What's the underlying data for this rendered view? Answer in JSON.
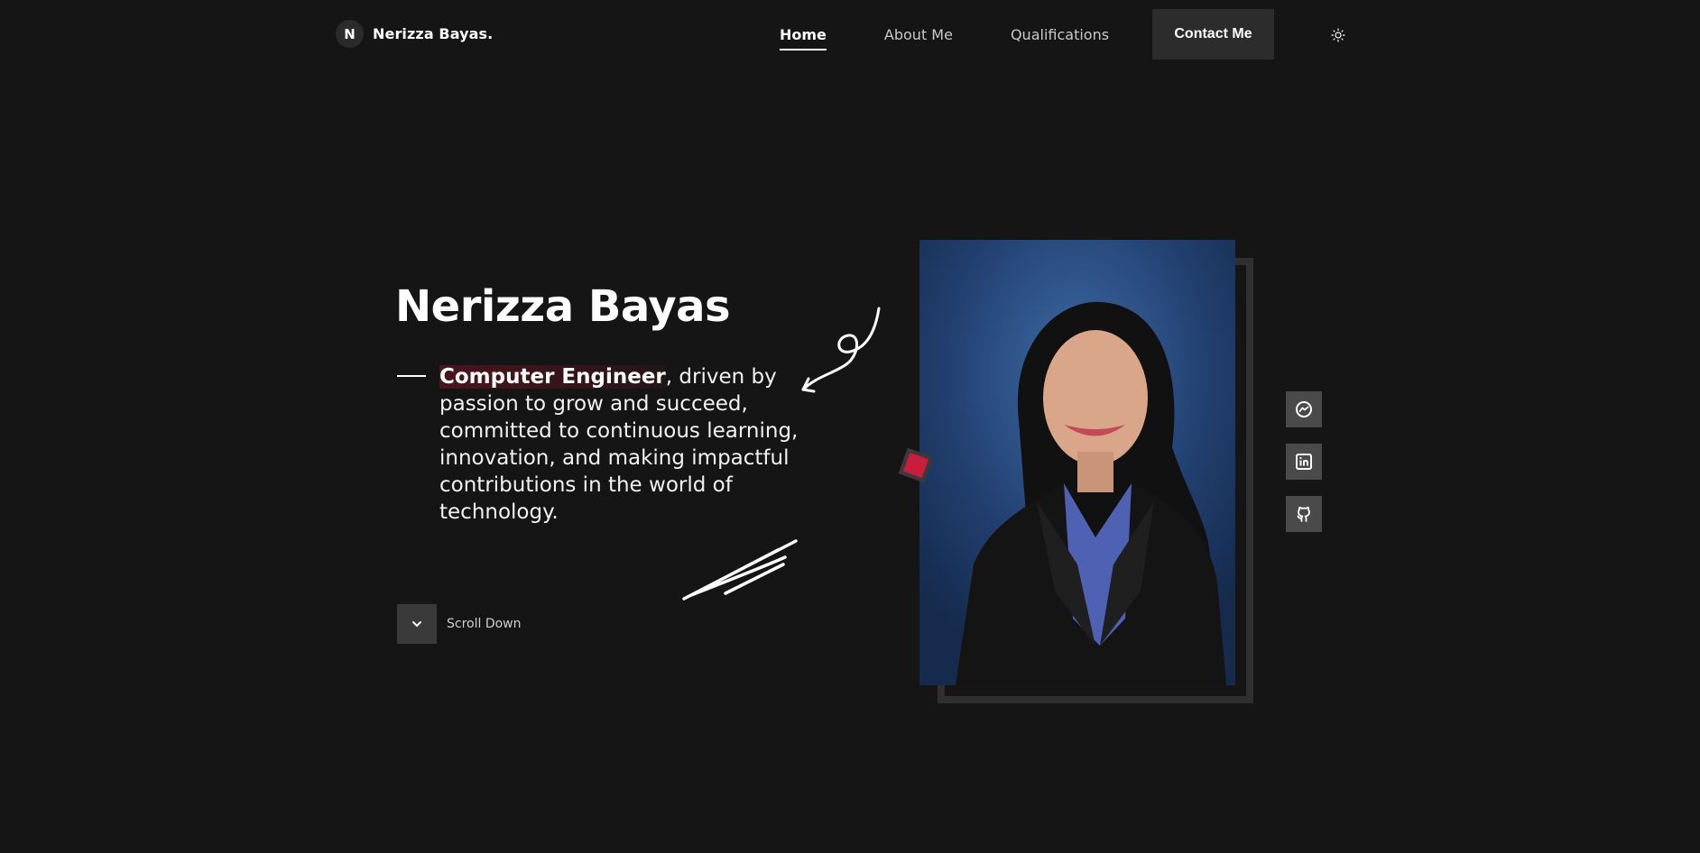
{
  "header": {
    "logo_letter": "N",
    "brand_name": "Nerizza Bayas.",
    "nav": [
      {
        "label": "Home",
        "active": true
      },
      {
        "label": "About Me",
        "active": false
      },
      {
        "label": "Qualifications",
        "active": false
      }
    ],
    "contact_label": "Contact Me",
    "theme_icon": "sun-icon"
  },
  "hero": {
    "name": "Nerizza Bayas",
    "role_highlight": "Computer Engineer",
    "description": ", driven by passion to grow and succeed, committed to continuous learning, innovation, and making impactful contributions in the world of technology.",
    "scroll_label": "Scroll Down"
  },
  "social": [
    {
      "name": "messenger-icon"
    },
    {
      "name": "linkedin-icon"
    },
    {
      "name": "github-icon"
    }
  ],
  "colors": {
    "background": "#151515",
    "accent": "#c81d3d",
    "button": "#2c2c2c"
  }
}
